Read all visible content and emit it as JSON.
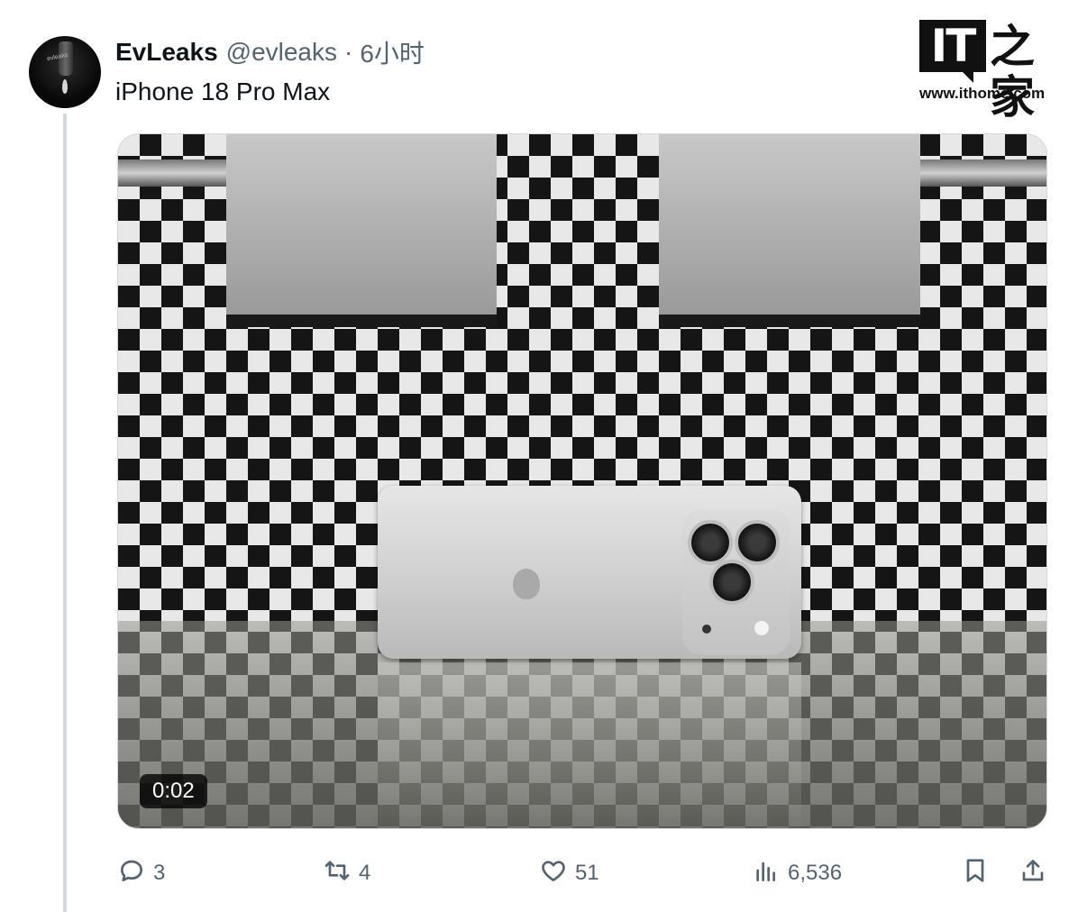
{
  "tweet": {
    "author_name": "EvLeaks",
    "author_handle": "@evleaks",
    "separator": "·",
    "time": "6小时",
    "text": "iPhone 18 Pro Max",
    "avatar_label": "evleaks"
  },
  "watermark": {
    "logo_text": "IT",
    "logo_cn": "之家",
    "url": "www.ithome.com"
  },
  "media": {
    "video_duration": "0:02"
  },
  "actions": {
    "replies": "3",
    "retweets": "4",
    "likes": "51",
    "views": "6,536"
  },
  "icons": [
    "reply-icon",
    "retweet-icon",
    "like-icon",
    "views-icon",
    "bookmark-icon",
    "share-icon"
  ],
  "colors": {
    "text": "#0f1419",
    "secondary": "#536471",
    "border": "#cfd9de"
  }
}
